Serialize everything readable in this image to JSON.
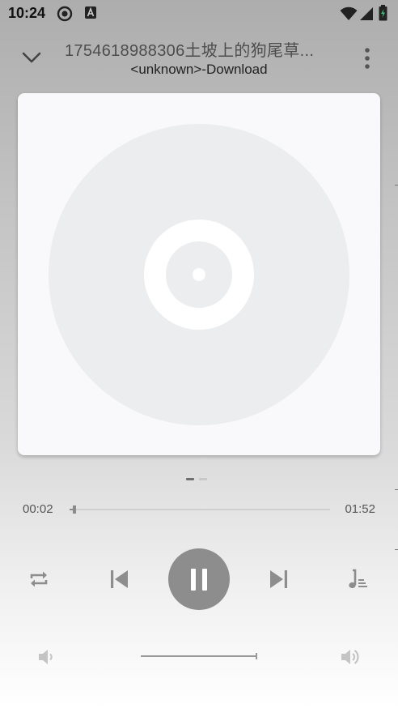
{
  "status_bar": {
    "time": "10:24",
    "icons": [
      "record-icon",
      "a-icon",
      "wifi-icon",
      "signal-icon",
      "battery-icon"
    ]
  },
  "header": {
    "title": "1754618988306土坡上的狗尾草...",
    "subtitle": "<unknown>-Download"
  },
  "pager": {
    "pages": 2,
    "current": 1
  },
  "player": {
    "current_time": "00:02",
    "total_time": "01:52",
    "progress": 0.018,
    "state": "playing"
  },
  "volume": {
    "level": 1.0
  },
  "colors": {
    "icon_gray": "#8d8d8d",
    "card_bg": "#f9f9fb",
    "disc_color": "#ecedef"
  }
}
